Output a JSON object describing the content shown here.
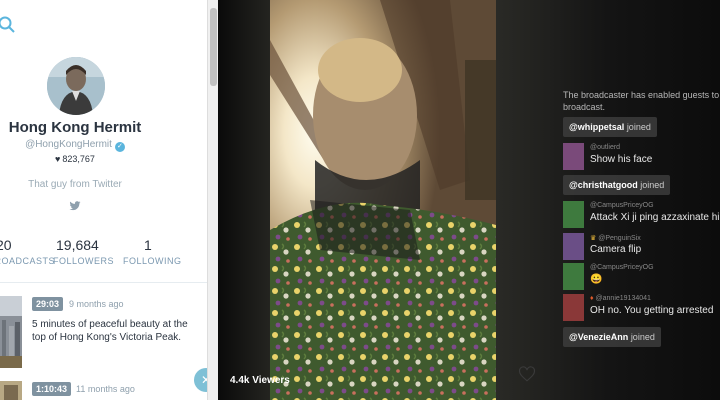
{
  "profile": {
    "name": "Hong Kong Hermit",
    "handle": "@HongKongHermit",
    "hearts": "823,767",
    "bio": "That guy from Twitter",
    "stats": [
      {
        "value": "20",
        "label": "BROADCASTS"
      },
      {
        "value": "19,684",
        "label": "FOLLOWERS"
      },
      {
        "value": "1",
        "label": "FOLLOWING"
      }
    ],
    "videos": [
      {
        "duration": "29:03",
        "ago": "9 months ago",
        "title": "5 minutes of peaceful beauty at the top of Hong Kong's Victoria Peak."
      },
      {
        "duration": "1:10:43",
        "ago": "11 months ago",
        "title": ""
      }
    ]
  },
  "broadcast": {
    "viewers": "4.4k Viewers"
  },
  "chat": {
    "notice": "The broadcaster has enabled guests to join this broadcast.",
    "joined_word": "joined",
    "entries": [
      {
        "kind": "joined",
        "user": "@whippetsal"
      },
      {
        "kind": "message",
        "user": "@outlierd",
        "text": "Show his face",
        "color": "#7a4a7a"
      },
      {
        "kind": "joined",
        "user": "@christhatgood"
      },
      {
        "kind": "message",
        "user": "@CampusPriceyOG",
        "text": "Attack Xi ji ping azzaxinate him",
        "color": "#3e7a3e"
      },
      {
        "kind": "message",
        "user": "@PenguinSix",
        "text": "Camera flip",
        "color": "#6a4e86"
      },
      {
        "kind": "message",
        "user": "@CampusPriceyOG",
        "text": "😀",
        "color": "#3e7a3e"
      },
      {
        "kind": "message",
        "user": "@annie19134041",
        "text": "OH no. You getting arrested",
        "color": "#8a3838"
      },
      {
        "kind": "joined",
        "user": "@VenezieAnn"
      }
    ]
  }
}
